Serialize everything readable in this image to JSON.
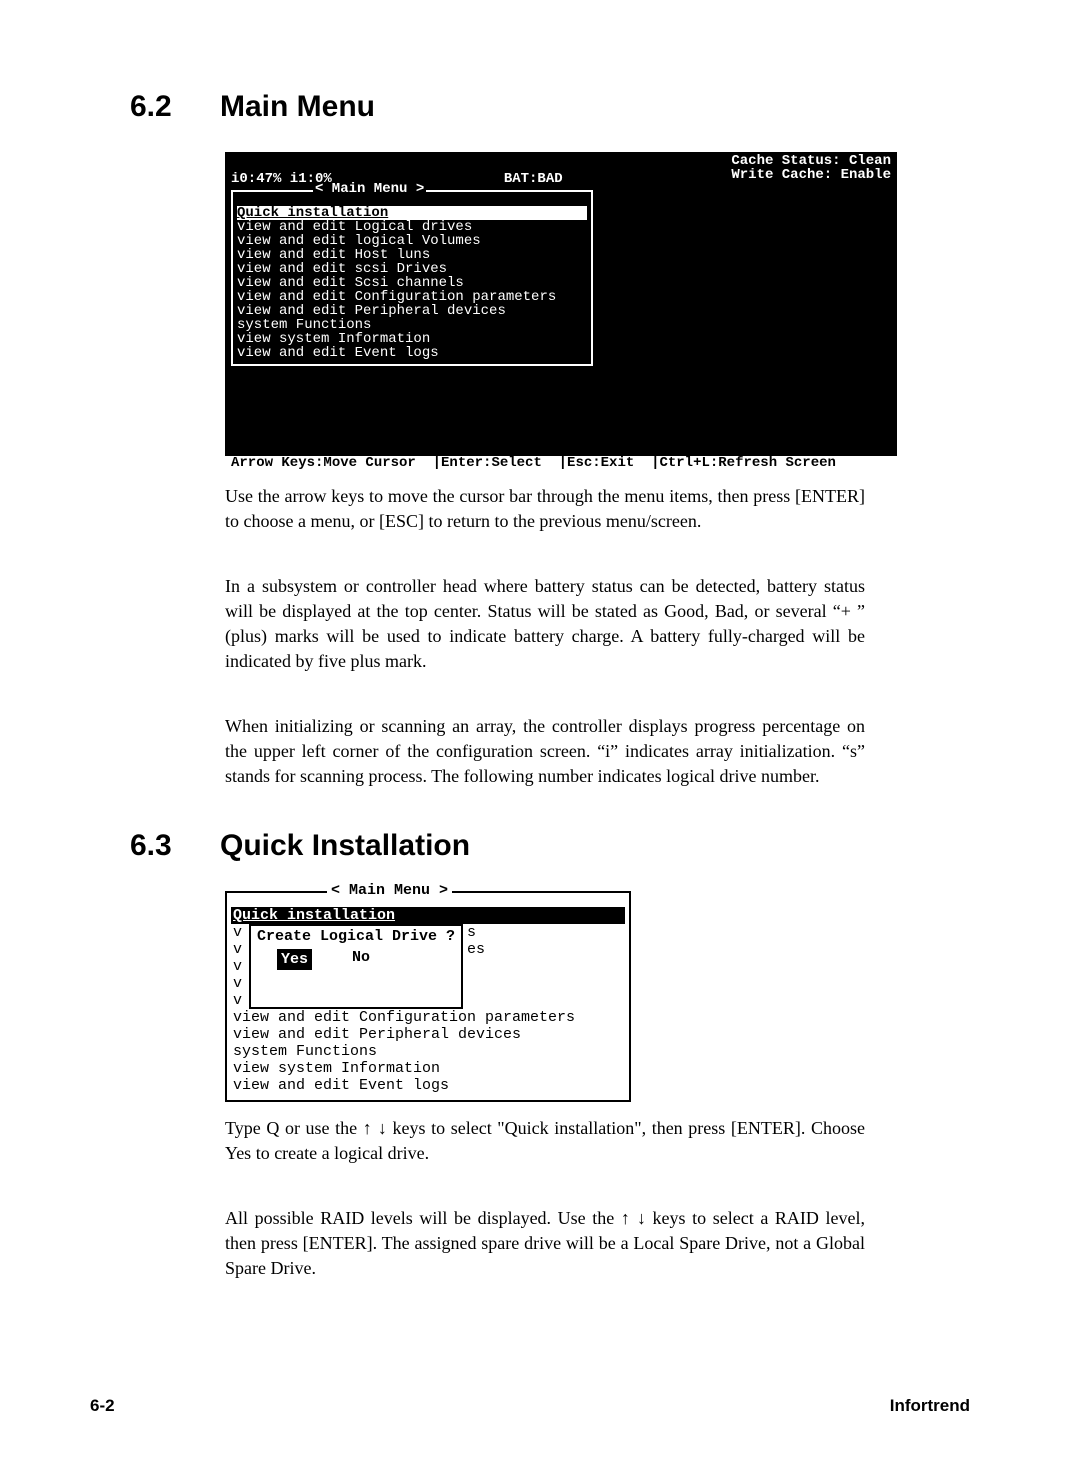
{
  "section62": {
    "num": "6.2",
    "title": "Main Menu"
  },
  "section63": {
    "num": "6.3",
    "title": "Quick Installation"
  },
  "term1": {
    "cache_status": "Cache Status: Clean",
    "write_cache": "Write Cache: Enable",
    "progress": "i0:47% i1:0%",
    "bat": "BAT:BAD",
    "menu_label": "< Main Menu >",
    "selected": "Quick installation",
    "items": [
      "view and edit Logical drives",
      "view and edit logical Volumes",
      "view and edit Host luns",
      "view and edit scsi Drives",
      "view and edit Scsi channels",
      "view and edit Configuration parameters",
      "view and edit Peripheral devices",
      "system Functions",
      "view system Information",
      "view and edit Event logs"
    ],
    "help": "Arrow Keys:Move Cursor  |Enter:Select  |Esc:Exit  |Ctrl+L:Refresh Screen"
  },
  "para62a": "Use the arrow keys to move the cursor bar through the menu items, then press [ENTER] to choose a menu, or [ESC] to return to the previous menu/screen.",
  "para62b": "In a subsystem or controller head where battery status can be detected, battery status will be displayed at the top center.  Status will be stated as Good, Bad, or several “+ ” (plus) marks will be used to indicate battery charge.  A battery fully-charged will be indicated by five plus mark.",
  "para62c": "When initializing or scanning an array, the controller displays progress percentage on the upper left corner of the configuration screen.  “i” indicates array initialization.  “s” stands for scanning process.  The following number indicates logical drive number.",
  "term2": {
    "menu_label": "< Main Menu >",
    "selected": "Quick installation",
    "v": "v",
    "right_s": "s",
    "right_es": "es",
    "dialog_q": "Create Logical Drive ?",
    "yes": "Yes",
    "no": "No",
    "items_below": [
      "view and edit Configuration parameters",
      "view and edit Peripheral devices",
      "system Functions",
      "view system Information",
      "view and edit Event logs"
    ]
  },
  "para63a_1": "Type Q or use the ",
  "para63a_2": " keys to select \"Quick installation\", then press [ENTER]. Choose Yes to create a logical drive.",
  "para63b_1": "All possible RAID levels will be displayed. Use the ",
  "para63b_2": " keys to select a RAID level, then press [ENTER]. The assigned spare drive will be a Local Spare Drive, not a Global Spare Drive.",
  "arrows": "↑ ↓",
  "footer": {
    "left": "6-2",
    "right": "Infortrend"
  }
}
